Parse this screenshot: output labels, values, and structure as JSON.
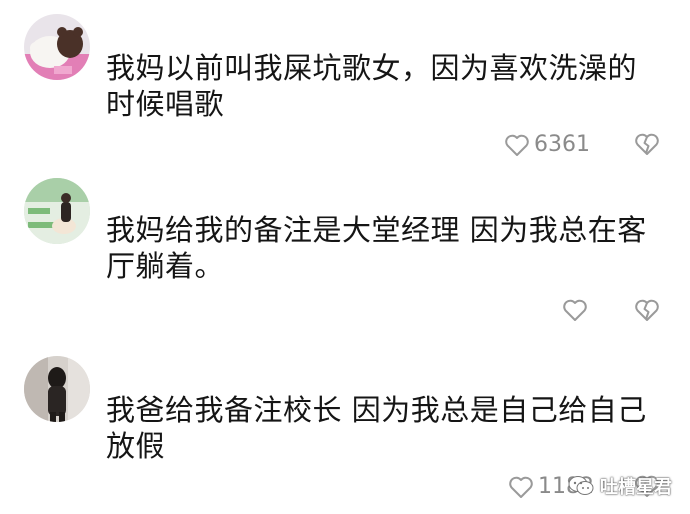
{
  "comments": [
    {
      "text": "我妈以前叫我屎坑歌女，因为喜欢洗澡的时候唱歌",
      "likes": "6361",
      "avatar": "avatar-plush-toys"
    },
    {
      "text": "我妈给我的备注是大堂经理 因为我总在客厅躺着。",
      "likes": "",
      "avatar": "avatar-person-on-stairs"
    },
    {
      "text": "我爸给我备注校长 因为我总是自己给自己放假",
      "likes": "1182",
      "avatar": "avatar-person-by-wall"
    }
  ],
  "watermark": {
    "text": "吐槽星君",
    "icon": "wechat-icon"
  },
  "colors": {
    "icon_gray": "#9a9a9a",
    "text": "#151515",
    "count": "#8a8a8a"
  }
}
